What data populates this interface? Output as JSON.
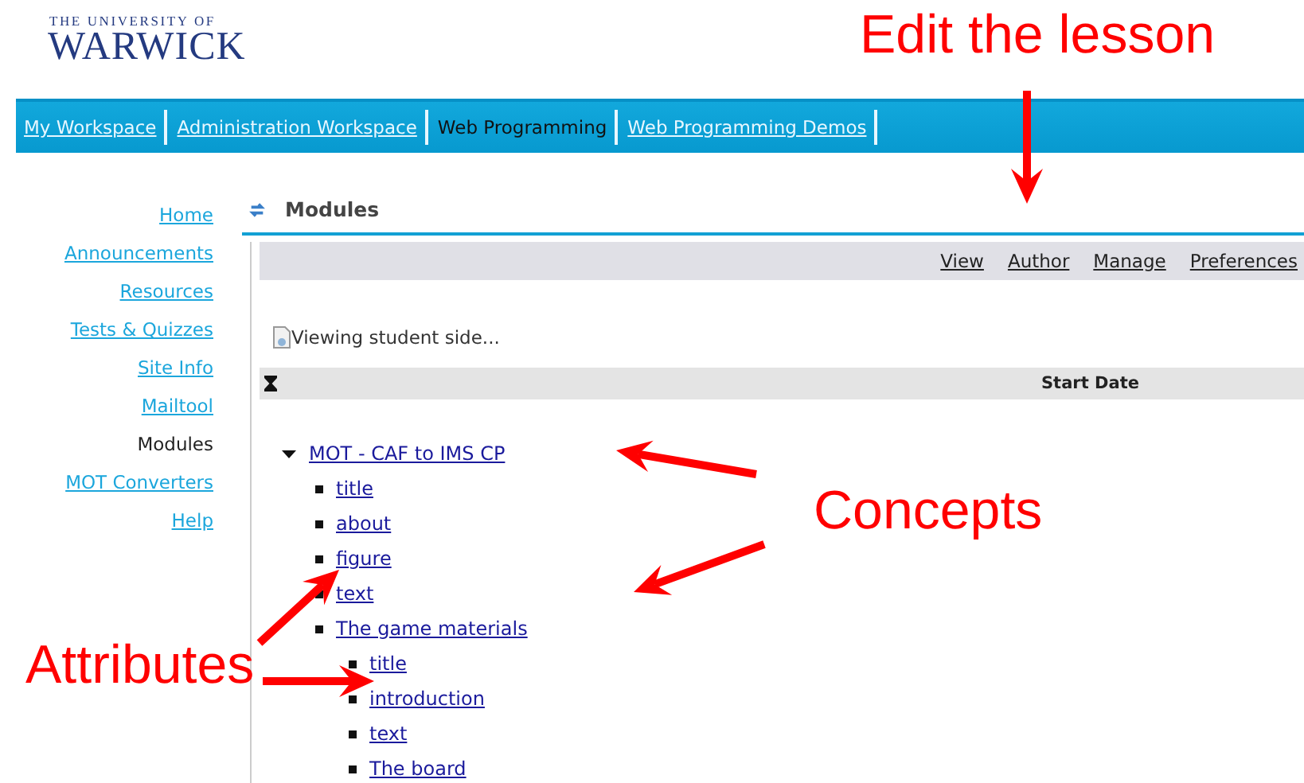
{
  "logo": {
    "line_1": "THE UNIVERSITY OF",
    "line_2": "WARWICK"
  },
  "nav_tabs": [
    {
      "label": "My Workspace",
      "selected": false
    },
    {
      "label": "Administration Workspace",
      "selected": false
    },
    {
      "label": "Web Programming",
      "selected": true
    },
    {
      "label": "Web Programming Demos",
      "selected": false
    }
  ],
  "sidebar": {
    "items": [
      {
        "label": "Home",
        "selected": false
      },
      {
        "label": "Announcements",
        "selected": false
      },
      {
        "label": "Resources",
        "selected": false
      },
      {
        "label": "Tests & Quizzes",
        "selected": false
      },
      {
        "label": "Site Info",
        "selected": false
      },
      {
        "label": "Mailtool",
        "selected": false
      },
      {
        "label": "Modules",
        "selected": true
      },
      {
        "label": "MOT Converters",
        "selected": false
      },
      {
        "label": "Help",
        "selected": false
      }
    ]
  },
  "page_title": "Modules",
  "toolbar": [
    "View",
    "Author",
    "Manage",
    "Preferences"
  ],
  "status": "Viewing student side...",
  "table": {
    "columns": [
      {
        "label": "Start Date"
      }
    ]
  },
  "tree": [
    {
      "label": "MOT - CAF to IMS CP",
      "expanded": true,
      "children": [
        {
          "label": "title"
        },
        {
          "label": "about"
        },
        {
          "label": "figure"
        },
        {
          "label": "text"
        },
        {
          "label": "The game materials",
          "children": [
            {
              "label": "title"
            },
            {
              "label": "introduction"
            },
            {
              "label": "text"
            },
            {
              "label": "The board"
            }
          ]
        }
      ]
    }
  ],
  "annotations": [
    {
      "text": "Edit the lesson"
    },
    {
      "text": "Concepts"
    },
    {
      "text": "Attributes"
    }
  ]
}
